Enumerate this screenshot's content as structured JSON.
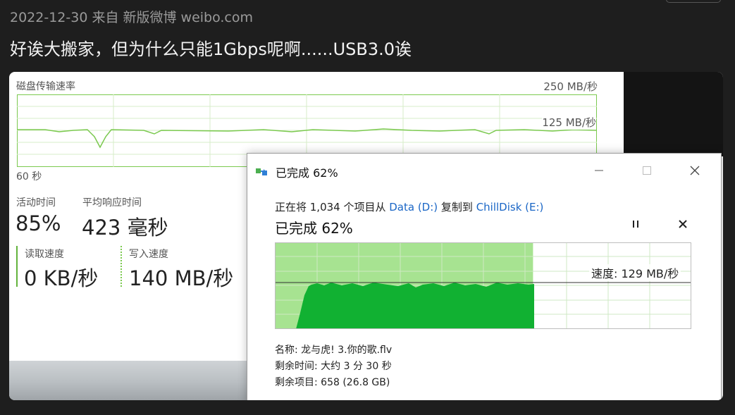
{
  "post": {
    "meta": "2022-12-30 来自 新版微博 weibo.com",
    "text": "好诶大搬家，但为什么只能1Gbps呢啊......USB3.0诶"
  },
  "task_manager": {
    "graph_title": "磁盘传输速率",
    "max_label": "250 MB/秒",
    "mid_label": "125 MB/秒",
    "time_label": "60 秒",
    "active_time_label": "活动时间",
    "active_time_value": "85%",
    "avg_response_label": "平均响应时间",
    "avg_response_value": "423 毫秒",
    "read_label": "读取速度",
    "read_value": "0 KB/秒",
    "write_label": "写入速度",
    "write_value": "140 MB/秒",
    "colors": {
      "graph_line": "#7bc94f",
      "read_accent": "#63b33c",
      "write_accent": "#7bc94f"
    }
  },
  "copy_dialog": {
    "title": "已完成 62%",
    "desc_prefix": "正在将 1,034 个项目从 ",
    "source": "Data (D:)",
    "desc_mid": " 复制到 ",
    "destination": "ChillDisk (E:)",
    "progress_title": "已完成 62%",
    "progress_fraction": 0.62,
    "speed_label": "速度: 129 MB/秒",
    "name_line": "名称:  龙与虎! 3.你的歌.flv",
    "time_left_line": "剩余时间:  大约 3 分 30 秒",
    "items_left_line": "剩余项目:  658 (26.8 GB)",
    "icons": [
      "copy-icon",
      "minimize-icon",
      "maximize-icon",
      "close-icon",
      "pause-icon",
      "cancel-icon"
    ],
    "colors": {
      "fill_light": "#a7e391",
      "fill_dark": "#11b132",
      "link": "#1a66c6"
    }
  }
}
